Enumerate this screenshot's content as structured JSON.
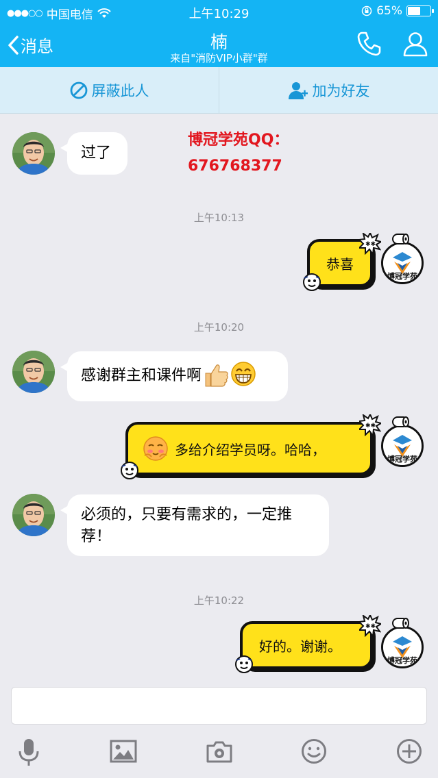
{
  "status_bar": {
    "carrier": "中国电信",
    "time": "上午10:29",
    "battery": "65%"
  },
  "nav": {
    "back_label": "消息",
    "title": "楠",
    "subtitle": "来自\"消防VIP小群\"群"
  },
  "actions": {
    "block_label": "屏蔽此人",
    "add_friend_label": "加为好友"
  },
  "watermark": {
    "line1": "博冠学苑QQ：",
    "line2": "676768377"
  },
  "messages": {
    "m1": "过了",
    "t1": "上午10:13",
    "m2": "恭喜",
    "t2": "上午10:20",
    "m3": "感谢群主和课件啊",
    "m4": "多给介绍学员呀。哈哈，",
    "m5": "必须的，只要有需求的，一定推荐！",
    "t3": "上午10:22",
    "m6": "好的。谢谢。"
  },
  "logo_text": "博冠学苑",
  "colors": {
    "nav_bg": "#14b4f4",
    "action_bar_bg": "#d9eef9",
    "action_text": "#1896d6",
    "chat_bg": "#ebebf0",
    "own_bubble": "#ffe11a",
    "watermark": "#e2171f"
  },
  "toolbar_icons": [
    "microphone-icon",
    "image-icon",
    "camera-icon",
    "emoji-icon",
    "plus-circle-icon"
  ]
}
